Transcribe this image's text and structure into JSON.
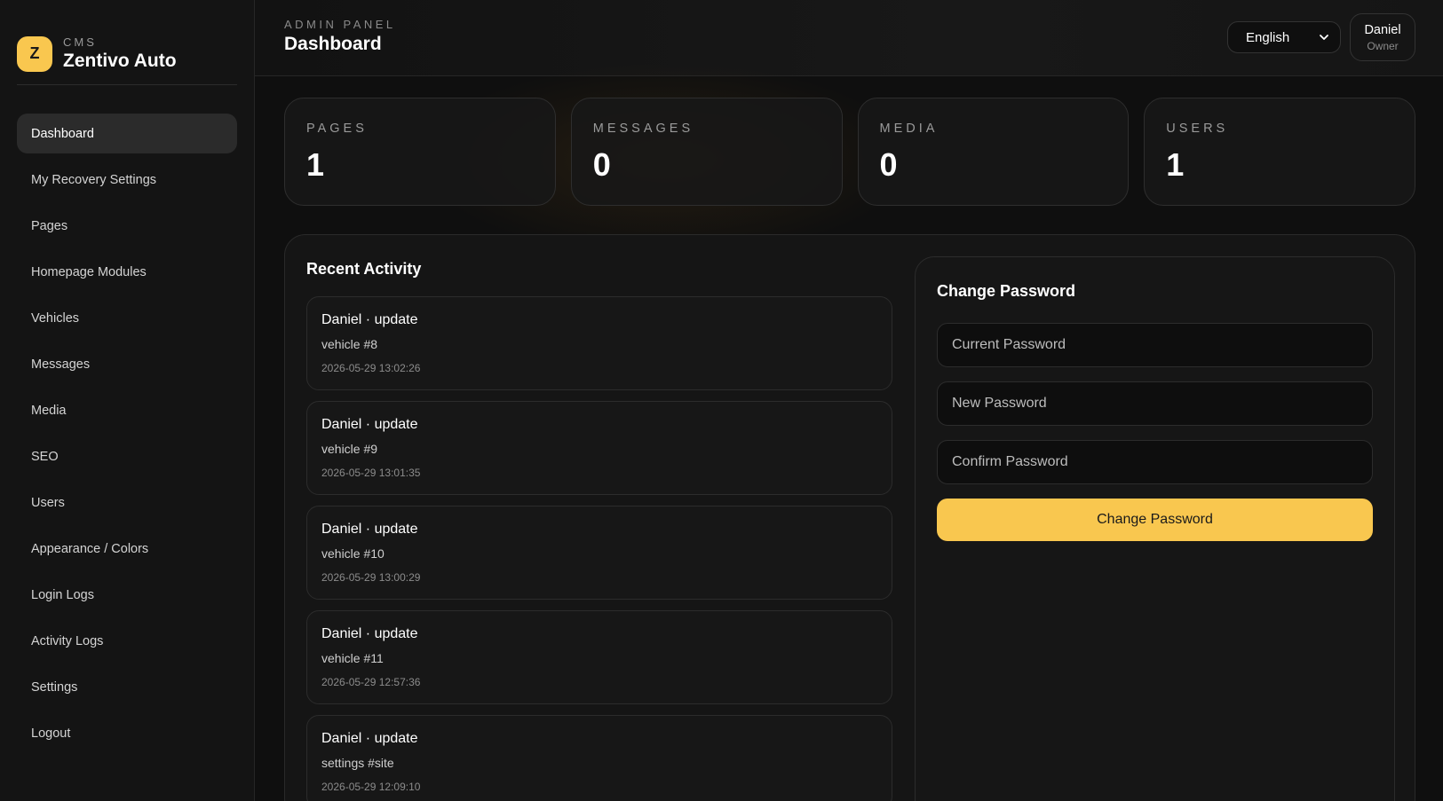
{
  "brand": {
    "logo_letter": "Z",
    "sub": "CMS",
    "name": "Zentivo Auto"
  },
  "sidebar": {
    "items": [
      {
        "label": "Dashboard",
        "active": true
      },
      {
        "label": "My Recovery Settings"
      },
      {
        "label": "Pages"
      },
      {
        "label": "Homepage Modules"
      },
      {
        "label": "Vehicles"
      },
      {
        "label": "Messages"
      },
      {
        "label": "Media"
      },
      {
        "label": "SEO"
      },
      {
        "label": "Users"
      },
      {
        "label": "Appearance / Colors"
      },
      {
        "label": "Login Logs"
      },
      {
        "label": "Activity Logs"
      },
      {
        "label": "Settings"
      },
      {
        "label": "Logout"
      }
    ]
  },
  "header": {
    "kicker": "ADMIN PANEL",
    "title": "Dashboard",
    "language": "English",
    "user_name": "Daniel",
    "user_role": "Owner"
  },
  "stats": [
    {
      "label": "PAGES",
      "value": "1"
    },
    {
      "label": "MESSAGES",
      "value": "0"
    },
    {
      "label": "MEDIA",
      "value": "0"
    },
    {
      "label": "USERS",
      "value": "1"
    }
  ],
  "activity": {
    "title": "Recent Activity",
    "items": [
      {
        "head": "Daniel · update",
        "target": "vehicle #8",
        "time": "2026-05-29 13:02:26"
      },
      {
        "head": "Daniel · update",
        "target": "vehicle #9",
        "time": "2026-05-29 13:01:35"
      },
      {
        "head": "Daniel · update",
        "target": "vehicle #10",
        "time": "2026-05-29 13:00:29"
      },
      {
        "head": "Daniel · update",
        "target": "vehicle #11",
        "time": "2026-05-29 12:57:36"
      },
      {
        "head": "Daniel · update",
        "target": "settings #site",
        "time": "2026-05-29 12:09:10"
      }
    ]
  },
  "password": {
    "title": "Change Password",
    "current_placeholder": "Current Password",
    "new_placeholder": "New Password",
    "confirm_placeholder": "Confirm Password",
    "button_label": "Change Password"
  },
  "colors": {
    "accent": "#f9c74f",
    "background": "#0f0f0f",
    "sidebar": "#141414"
  }
}
